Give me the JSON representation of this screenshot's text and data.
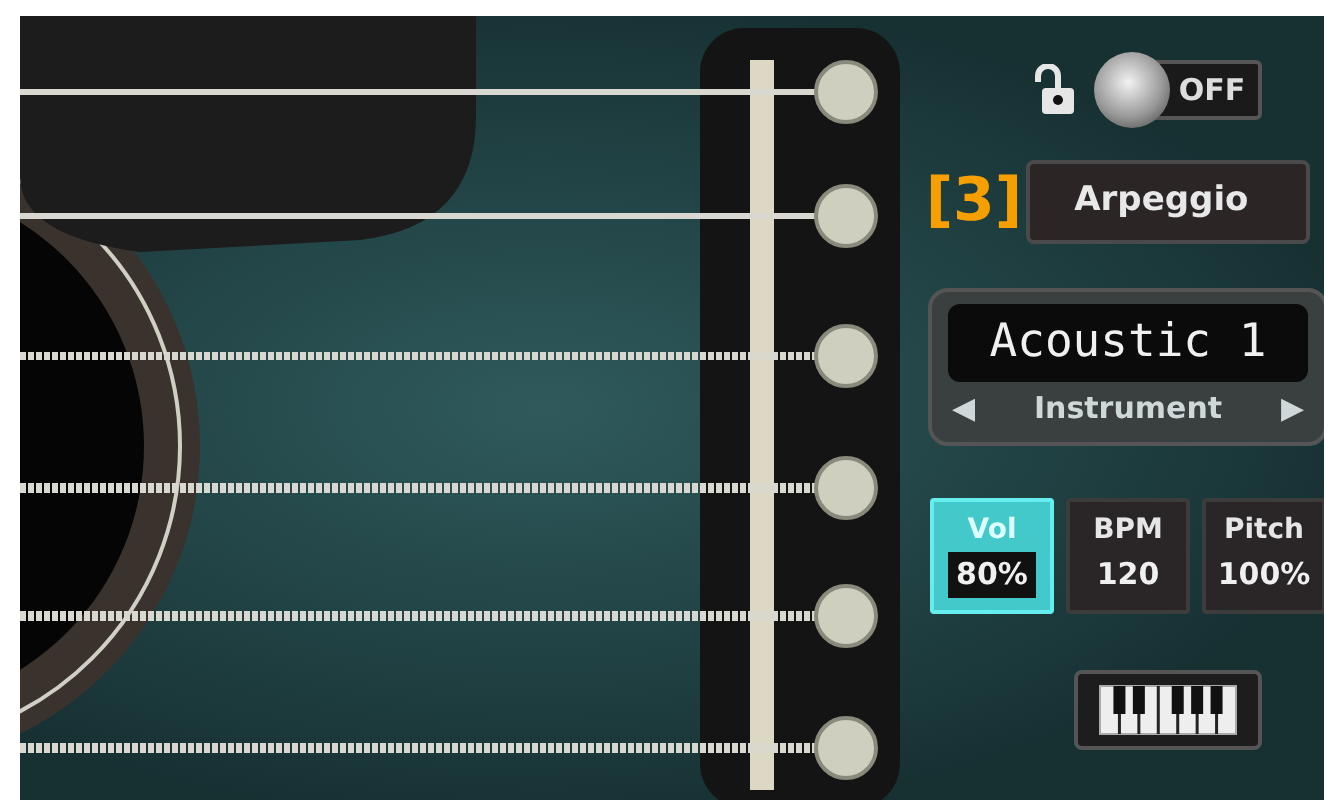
{
  "lock": {
    "locked": false
  },
  "power_toggle": {
    "label": "OFF",
    "on": false
  },
  "callout": "[3]",
  "arpeggio_button": {
    "label": "Arpeggio"
  },
  "instrument": {
    "name": "Acoustic 1",
    "prev": "◀",
    "label": "Instrument",
    "next": "▶"
  },
  "params": [
    {
      "label": "Vol",
      "value": "80%",
      "selected": true
    },
    {
      "label": "BPM",
      "value": "120",
      "selected": false
    },
    {
      "label": "Pitch",
      "value": "100%",
      "selected": false
    }
  ]
}
